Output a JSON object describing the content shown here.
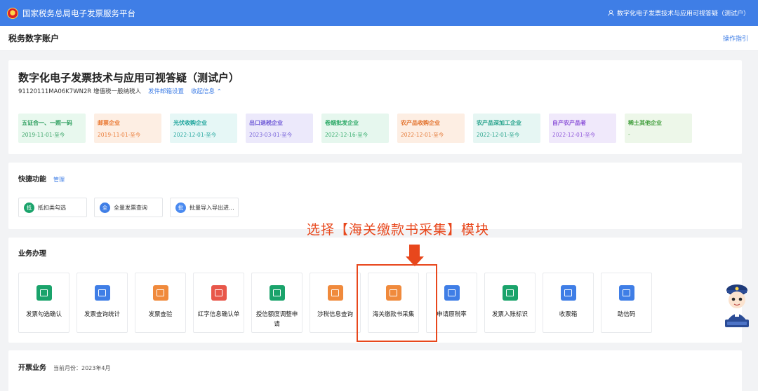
{
  "header": {
    "platform_title": "国家税务总局电子发票服务平台",
    "user_label": "数字化电子发票技术与应用可视答疑（测试户）"
  },
  "subheader": {
    "title": "税务数字账户",
    "guide_link": "操作指引"
  },
  "company": {
    "name": "数字化电子发票技术与应用可视答疑（测试户）",
    "tax_id_and_type": "91120111MA06K7WN2R 增值税一般纳税人",
    "link_email": "发件邮箱设置",
    "link_collapse": "收起信息"
  },
  "tags": [
    {
      "name": "五证合一、一照一码",
      "date": "2019-11-01-至今",
      "style": "t-green"
    },
    {
      "name": "邮票企业",
      "date": "2019-11-01-至今",
      "style": "t-orange"
    },
    {
      "name": "光伏收购企业",
      "date": "2022-12-01-至今",
      "style": "t-cyan"
    },
    {
      "name": "出口退税企业",
      "date": "2023-03-01-至今",
      "style": "t-purple"
    },
    {
      "name": "卷烟批发企业",
      "date": "2022-12-16-至今",
      "style": "t-mint"
    },
    {
      "name": "农产品收购企业",
      "date": "2022-12-01-至今",
      "style": "t-peach"
    },
    {
      "name": "农产品深加工企业",
      "date": "2022-12-01-至今",
      "style": "t-teal"
    },
    {
      "name": "自产农产品者",
      "date": "2022-12-01-至今",
      "style": "t-violet"
    },
    {
      "name": "稀土其他企业",
      "date": "-",
      "style": "t-lime"
    }
  ],
  "quick": {
    "title": "快捷功能",
    "manage": "管理",
    "items": [
      {
        "icon_char": "抵",
        "label": "抵扣类勾选",
        "color": "#1aa36b"
      },
      {
        "icon_char": "全",
        "label": "全量发票查询",
        "color": "#3f7ee6"
      },
      {
        "icon_char": "批",
        "label": "批量导入导出进...",
        "color": "#4a8af0"
      }
    ]
  },
  "business": {
    "title": "业务办理",
    "items": [
      {
        "label": "发票勾选确认",
        "color": "#1aa36b",
        "icon": "check-invoice-icon"
      },
      {
        "label": "发票查询统计",
        "color": "#3f7ee6",
        "icon": "search-invoice-icon"
      },
      {
        "label": "发票查验",
        "color": "#f08a3c",
        "icon": "verify-invoice-icon"
      },
      {
        "label": "红字信息确认单",
        "color": "#e8574a",
        "icon": "red-letter-icon"
      },
      {
        "label": "授信额度调整申请",
        "color": "#1aa36b",
        "icon": "credit-adjust-icon"
      },
      {
        "label": "涉税信息查询",
        "color": "#f08a3c",
        "icon": "tax-info-icon"
      },
      {
        "label": "海关缴款书采集",
        "color": "#f08a3c",
        "icon": "customs-payment-icon"
      },
      {
        "label": "申请原税率",
        "color": "#3f7ee6",
        "icon": "apply-rate-icon"
      },
      {
        "label": "发票入账标识",
        "color": "#1aa36b",
        "icon": "entry-mark-icon"
      },
      {
        "label": "收票箱",
        "color": "#3f7ee6",
        "icon": "inbox-icon"
      },
      {
        "label": "助信码",
        "color": "#3f7ee6",
        "icon": "qr-code-icon"
      }
    ]
  },
  "invoicing": {
    "title": "开票业务",
    "month": "当前月份：2023年4月"
  },
  "annotation": {
    "text": "选择【海关缴款书采集】模块"
  }
}
